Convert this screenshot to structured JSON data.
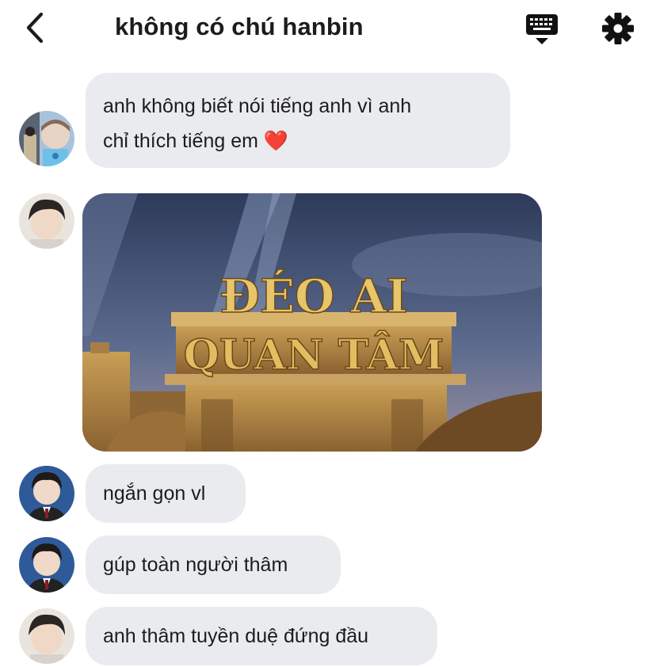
{
  "header": {
    "title": "không có chú hanbin",
    "back_icon": "chevron-left-icon",
    "keyboard_icon": "keyboard-icon",
    "settings_icon": "gear-icon"
  },
  "messages": [
    {
      "type": "text",
      "line1": "anh không biết nói tiếng anh vì anh",
      "line2": "chỉ thích tiếng em",
      "emoji": "❤️"
    },
    {
      "type": "image",
      "image_text_line1": "ĐÉO AI",
      "image_text_line2": "QUAN TÂM"
    },
    {
      "type": "text",
      "text": "ngắn gọn vl"
    },
    {
      "type": "text",
      "text": "gúp toàn người thâm"
    },
    {
      "type": "text",
      "text": "anh thâm tuyền duệ đứng đầu"
    }
  ],
  "colors": {
    "bubble": "#e9ebef",
    "text": "#1c1c1e",
    "heart": "#e0364a"
  }
}
